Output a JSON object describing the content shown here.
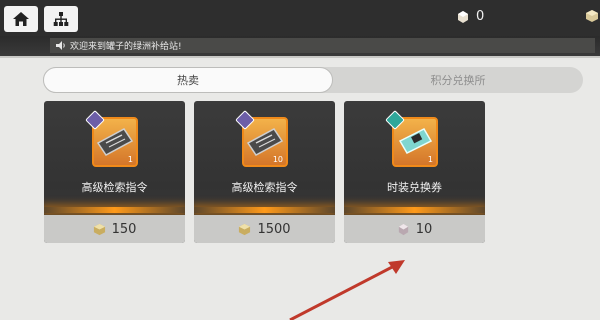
{
  "currency": [
    {
      "value": "0",
      "icon": "cube-icon"
    },
    {
      "value": "",
      "icon": "cube-icon"
    }
  ],
  "announcement": "欢迎来到罐子的绿洲补给站!",
  "tabs": {
    "hot": "热卖",
    "points_exchange": "积分兑换所"
  },
  "items": [
    {
      "title": "高级检索指令",
      "qty": "1",
      "price": "150",
      "currency_icon": "cube-icon",
      "badge_color": "#6c5ea7"
    },
    {
      "title": "高级检索指令",
      "qty": "10",
      "price": "1500",
      "currency_icon": "cube-icon",
      "badge_color": "#6c5ea7"
    },
    {
      "title": "时装兑换券",
      "qty": "1",
      "price": "10",
      "currency_icon": "gem-icon",
      "badge_color": "#2fa79a"
    }
  ],
  "colors": {
    "accent_orange": "#ff9a1a",
    "topbar": "#2e2e2e",
    "arrow": "#c0392b"
  }
}
